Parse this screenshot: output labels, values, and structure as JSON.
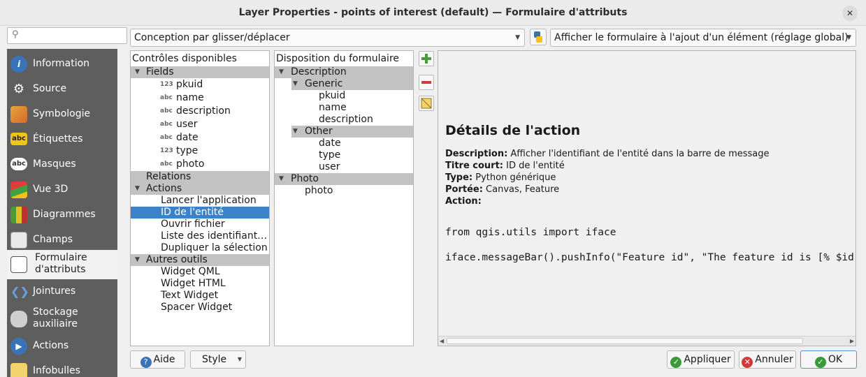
{
  "window": {
    "title": "Layer Properties - points of interest (default) — Formulaire d'attributs",
    "close_glyph": "✕"
  },
  "search": {
    "placeholder": "",
    "icon": "search-icon"
  },
  "sidebar": {
    "items": [
      {
        "label": "Information",
        "icon": "info-icon"
      },
      {
        "label": "Source",
        "icon": "source-icon"
      },
      {
        "label": "Symbologie",
        "icon": "symbology-icon"
      },
      {
        "label": "Étiquettes",
        "icon": "labels-icon"
      },
      {
        "label": "Masques",
        "icon": "masks-icon"
      },
      {
        "label": "Vue 3D",
        "icon": "3d-view-icon"
      },
      {
        "label": "Diagrammes",
        "icon": "diagrams-icon"
      },
      {
        "label": "Champs",
        "icon": "fields-icon"
      },
      {
        "label": "Formulaire",
        "label2": "d'attributs",
        "icon": "attributes-form-icon"
      },
      {
        "label": "Jointures",
        "icon": "joins-icon"
      },
      {
        "label": "Stockage",
        "label2": "auxiliaire",
        "icon": "auxiliary-storage-icon"
      },
      {
        "label": "Actions",
        "icon": "actions-icon"
      },
      {
        "label": "Infobulles",
        "icon": "tooltips-icon"
      }
    ]
  },
  "toolbar": {
    "designer_mode": "Conception par glisser/déplacer",
    "form_open_mode": "Afficher le formulaire à l'ajout d'un élément (réglage global)"
  },
  "available": {
    "title": "Contrôles disponibles",
    "fields_label": "Fields",
    "fields": [
      {
        "type": "123",
        "name": "pkuid"
      },
      {
        "type": "abc",
        "name": "name"
      },
      {
        "type": "abc",
        "name": "description"
      },
      {
        "type": "abc",
        "name": "user"
      },
      {
        "type": "abc",
        "name": "date"
      },
      {
        "type": "123",
        "name": "type"
      },
      {
        "type": "abc",
        "name": "photo"
      }
    ],
    "relations_label": "Relations",
    "actions_label": "Actions",
    "actions": [
      "Lancer l'application",
      "ID de l'entité",
      "Ouvrir fichier",
      "Liste des identifiant…",
      "Dupliquer la sélection"
    ],
    "other_label": "Autres outils",
    "other": [
      "Widget QML",
      "Widget HTML",
      "Text Widget",
      "Spacer Widget"
    ]
  },
  "layout": {
    "title": "Disposition du formulaire",
    "description_label": "Description",
    "generic_label": "Generic",
    "generic": [
      "pkuid",
      "name",
      "description"
    ],
    "other_label": "Other",
    "other": [
      "date",
      "type",
      "user"
    ],
    "photo_label": "Photo",
    "photo": [
      "photo"
    ]
  },
  "detail": {
    "heading": "Détails de l'action",
    "desc_key": "Description:",
    "desc_val": " Afficher l'identifiant de l'entité dans la barre de message",
    "short_key": "Titre court:",
    "short_val": " ID de l'entité",
    "type_key": "Type:",
    "type_val": " Python générique",
    "scope_key": "Portée:",
    "scope_val": " Canvas, Feature",
    "action_key": "Action:",
    "code1": "from qgis.utils import iface",
    "code2": "iface.messageBar().pushInfo(\"Feature id\", \"The feature id is [% $id %]\")"
  },
  "buttons": {
    "help": "Aide",
    "style": "Style",
    "apply": "Appliquer",
    "cancel": "Annuler",
    "ok": "OK"
  }
}
